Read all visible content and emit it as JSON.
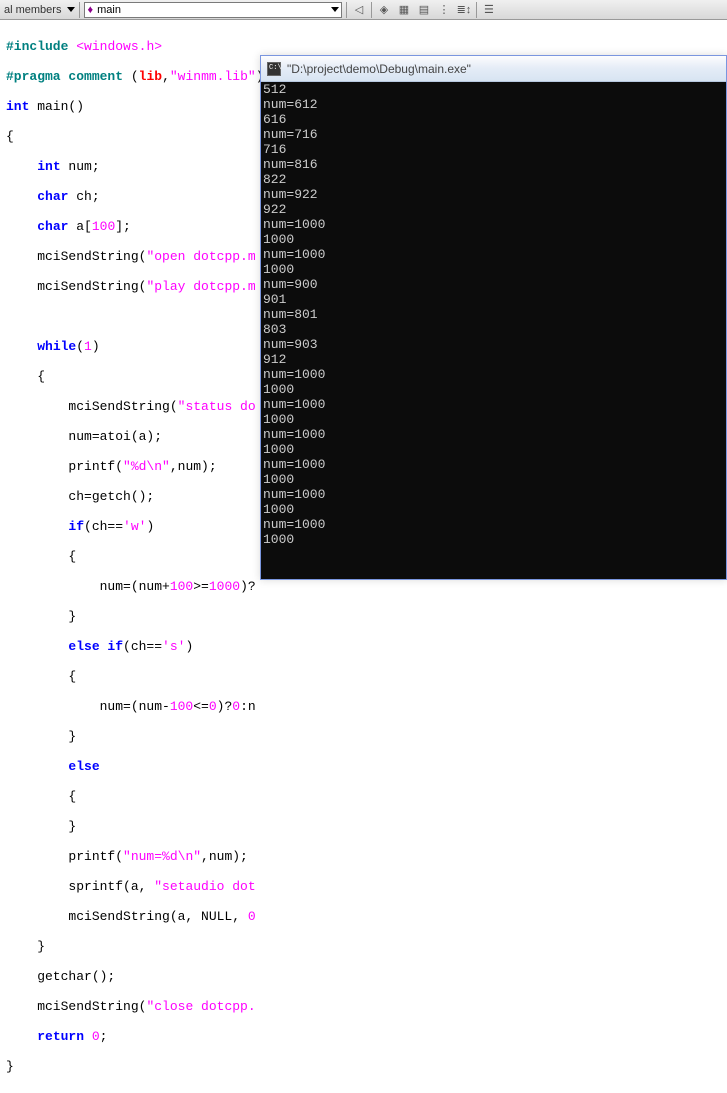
{
  "toolbar": {
    "left_label": "al members",
    "dropdown_label": "main"
  },
  "console": {
    "title": "\"D:\\project\\demo\\Debug\\main.exe\"",
    "lines": [
      "512",
      "num=612",
      "616",
      "num=716",
      "716",
      "num=816",
      "822",
      "num=922",
      "922",
      "num=1000",
      "1000",
      "num=1000",
      "1000",
      "num=900",
      "901",
      "num=801",
      "803",
      "num=903",
      "912",
      "num=1000",
      "1000",
      "num=1000",
      "1000",
      "num=1000",
      "1000",
      "num=1000",
      "1000",
      "num=1000",
      "1000",
      "num=1000",
      "1000"
    ]
  },
  "code": {
    "l1a": "#include",
    "l1b": "<windows.h>",
    "l2a": "#pragma",
    "l2b": "comment",
    "l2c": "(",
    "l2d": "lib",
    "l2e": ",",
    "l2f": "\"winmm.lib\"",
    "l2g": ")",
    "l3a": "int",
    "l3b": " main()",
    "l4": "{",
    "l5a": "    ",
    "l5b": "int",
    "l5c": " num;",
    "l6a": "    ",
    "l6b": "char",
    "l6c": " ch;",
    "l7a": "    ",
    "l7b": "char",
    "l7c": " a[",
    "l7d": "100",
    "l7e": "];",
    "l8a": "    mciSendString(",
    "l8b": "\"open dotcpp.m",
    "l9a": "    mciSendString(",
    "l9b": "\"play dotcpp.m",
    "l10": " ",
    "l11a": "    ",
    "l11b": "while",
    "l11c": "(",
    "l11d": "1",
    "l11e": ")",
    "l12": "    {",
    "l13a": "        mciSendString(",
    "l13b": "\"status do",
    "l14": "        num=atoi(a);",
    "l15a": "        printf(",
    "l15b": "\"%d\\n\"",
    "l15c": ",num);",
    "l16": "        ch=getch();",
    "l17a": "        ",
    "l17b": "if",
    "l17c": "(ch==",
    "l17d": "'w'",
    "l17e": ")",
    "l18": "        {",
    "l19a": "            num=(num+",
    "l19b": "100",
    "l19c": ">=",
    "l19d": "1000",
    "l19e": ")?",
    "l20": "        }",
    "l21a": "        ",
    "l21b": "else if",
    "l21c": "(ch==",
    "l21d": "'s'",
    "l21e": ")",
    "l22": "        {",
    "l23a": "            num=(num-",
    "l23b": "100",
    "l23c": "<=",
    "l23d": "0",
    "l23e": ")?",
    "l23f": "0",
    "l23g": ":n",
    "l24": "        }",
    "l25a": "        ",
    "l25b": "else",
    "l26": "        {",
    "l27": "        }",
    "l28a": "        printf(",
    "l28b": "\"num=%d\\n\"",
    "l28c": ",num);",
    "l29a": "        sprintf(a, ",
    "l29b": "\"setaudio dot",
    "l30a": "        mciSendString(a, NULL, ",
    "l30b": "0",
    "l31": "    }",
    "l32": "    getchar();",
    "l33a": "    mciSendString(",
    "l33b": "\"close dotcpp.",
    "l34a": "    ",
    "l34b": "return",
    "l34c": " ",
    "l34d": "0",
    "l34e": ";",
    "l35": "}"
  }
}
